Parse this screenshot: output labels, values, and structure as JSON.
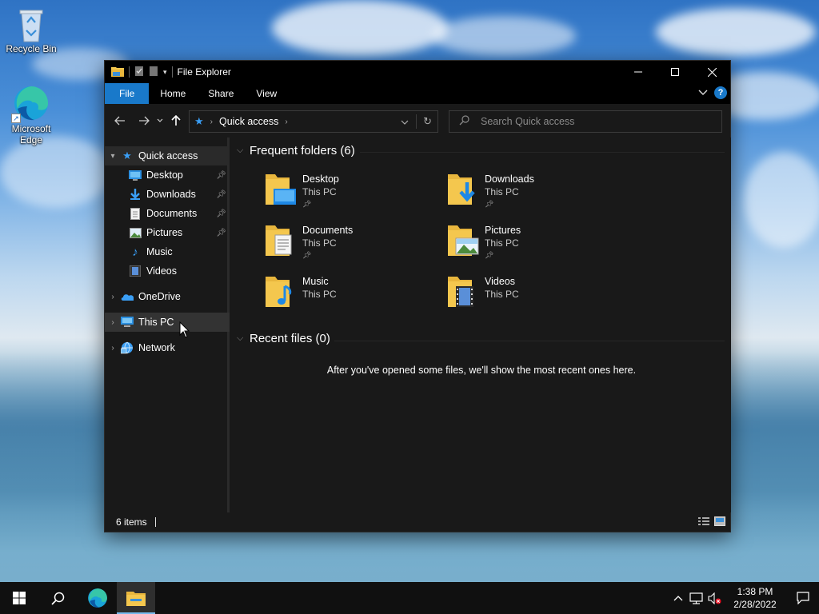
{
  "desktop": {
    "icons": [
      {
        "label": "Recycle Bin",
        "icon": "recycle-bin-icon"
      },
      {
        "label": "Microsoft Edge",
        "icon": "edge-icon"
      }
    ]
  },
  "window": {
    "title": "File Explorer",
    "ribbon_tabs": [
      "File",
      "Home",
      "Share",
      "View"
    ],
    "help_label": "?",
    "address": {
      "location": "Quick access"
    },
    "search": {
      "placeholder": "Search Quick access"
    },
    "nav_pane": {
      "quick_access": "Quick access",
      "items": [
        {
          "label": "Desktop",
          "icon": "desktop-icon",
          "pinned": true
        },
        {
          "label": "Downloads",
          "icon": "downloads-icon",
          "pinned": true
        },
        {
          "label": "Documents",
          "icon": "documents-icon",
          "pinned": true
        },
        {
          "label": "Pictures",
          "icon": "pictures-icon",
          "pinned": true
        },
        {
          "label": "Music",
          "icon": "music-icon",
          "pinned": false
        },
        {
          "label": "Videos",
          "icon": "videos-icon",
          "pinned": false
        }
      ],
      "onedrive": "OneDrive",
      "this_pc": "This PC",
      "network": "Network"
    },
    "frequent_folders": {
      "header": "Frequent folders (6)",
      "folders": [
        {
          "name": "Desktop",
          "location": "This PC",
          "pinned": true
        },
        {
          "name": "Downloads",
          "location": "This PC",
          "pinned": true
        },
        {
          "name": "Documents",
          "location": "This PC",
          "pinned": true
        },
        {
          "name": "Pictures",
          "location": "This PC",
          "pinned": true
        },
        {
          "name": "Music",
          "location": "This PC",
          "pinned": false
        },
        {
          "name": "Videos",
          "location": "This PC",
          "pinned": false
        }
      ]
    },
    "recent_files": {
      "header": "Recent files (0)",
      "empty_message": "After you've opened some files, we'll show the most recent ones here."
    },
    "status": {
      "item_count": "6 items"
    }
  },
  "taskbar": {
    "clock_time": "1:38 PM",
    "clock_date": "2/28/2022"
  },
  "colors": {
    "accent": "#1979ca",
    "window_bg": "#191919",
    "folder": "#f4c74e"
  }
}
